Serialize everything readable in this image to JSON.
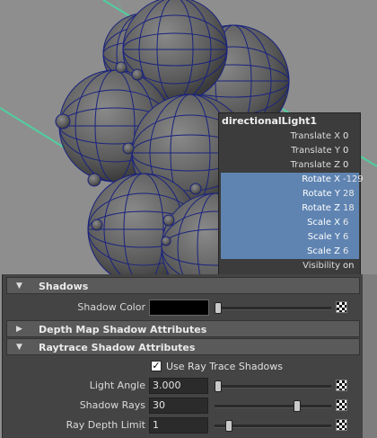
{
  "channel_box": {
    "title": "directionalLight1",
    "rows": [
      {
        "label": "Translate X",
        "value": "0",
        "selected": false
      },
      {
        "label": "Translate Y",
        "value": "0",
        "selected": false
      },
      {
        "label": "Translate Z",
        "value": "0",
        "selected": false
      },
      {
        "label": "Rotate X",
        "value": "-129",
        "selected": true
      },
      {
        "label": "Rotate Y",
        "value": "28",
        "selected": true
      },
      {
        "label": "Rotate Z",
        "value": "18",
        "selected": true
      },
      {
        "label": "Scale X",
        "value": "6",
        "selected": true
      },
      {
        "label": "Scale Y",
        "value": "6",
        "selected": true
      },
      {
        "label": "Scale Z",
        "value": "6",
        "selected": true
      },
      {
        "label": "Visibility",
        "value": "on",
        "selected": false
      }
    ]
  },
  "attributes": {
    "shadows_title": "Shadows",
    "shadow_color_label": "Shadow Color",
    "depth_map_title": "Depth Map Shadow Attributes",
    "raytrace_title": "Raytrace Shadow Attributes",
    "use_ray_trace_label": "Use Ray Trace Shadows",
    "use_ray_trace_checked": true,
    "light_angle_label": "Light Angle",
    "light_angle_value": "3.000",
    "shadow_rays_label": "Shadow Rays",
    "shadow_rays_value": "30",
    "ray_depth_label": "Ray Depth Limit",
    "ray_depth_value": "1"
  },
  "icons": {
    "expanded": "triangle-down-icon",
    "collapsed": "triangle-right-icon",
    "map": "checker-map-icon",
    "check": "checkmark-icon"
  },
  "colors": {
    "selection": "#5f84b2",
    "wireframe": "#1a237e",
    "light_line": "#4fd0a0"
  }
}
